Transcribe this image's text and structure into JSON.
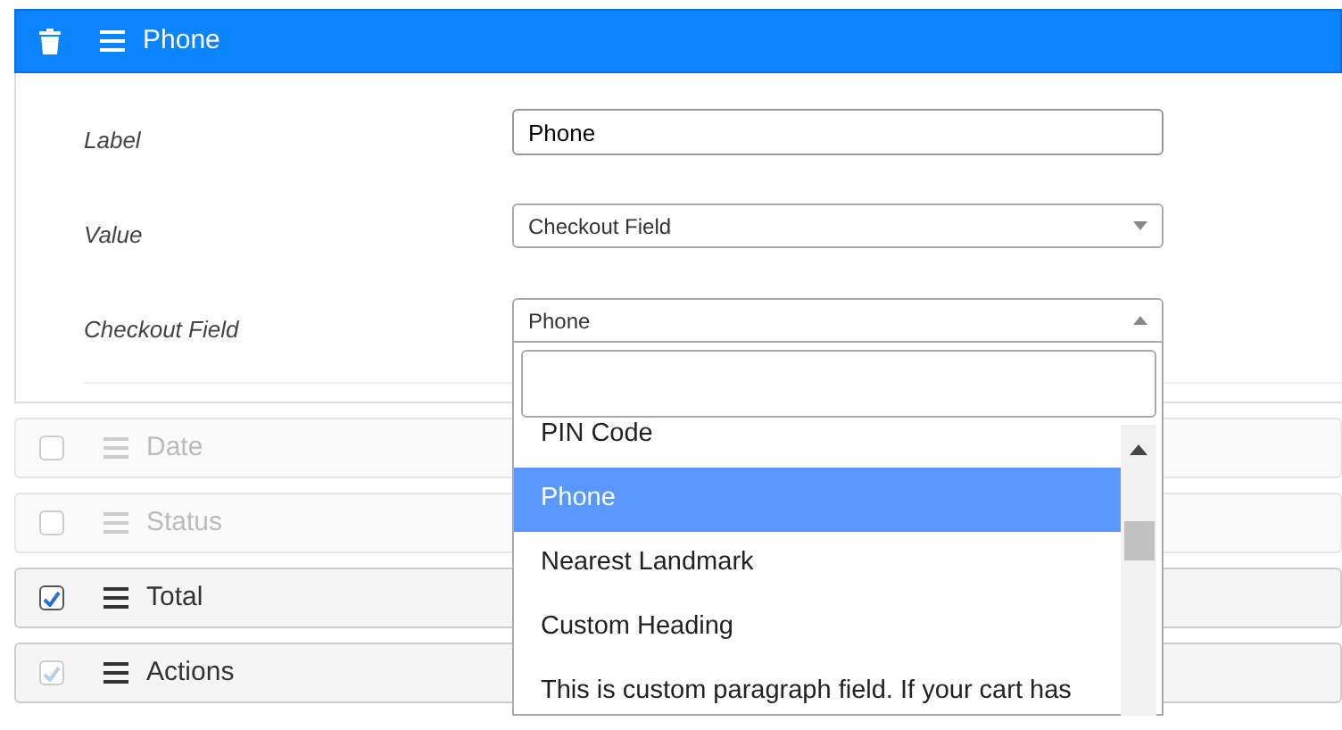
{
  "panel": {
    "title": "Phone",
    "fields": [
      {
        "label": "Label",
        "kind": "text",
        "value": "Phone"
      },
      {
        "label": "Value",
        "kind": "select",
        "value": "Checkout Field",
        "open": false
      },
      {
        "label": "Checkout Field",
        "kind": "select",
        "value": "Phone",
        "open": true
      }
    ]
  },
  "dropdown": {
    "options": [
      {
        "label": "PIN Code",
        "selected": false
      },
      {
        "label": "Phone",
        "selected": true
      },
      {
        "label": "Nearest Landmark",
        "selected": false
      },
      {
        "label": "Custom Heading",
        "selected": false
      },
      {
        "label": "This is custom paragraph field. If your cart has",
        "selected": false
      }
    ]
  },
  "columns": [
    {
      "label": "Date",
      "checked": false,
      "disabled": true,
      "dimmed": true
    },
    {
      "label": "Status",
      "checked": false,
      "disabled": true,
      "dimmed": true
    },
    {
      "label": "Total",
      "checked": true,
      "disabled": false,
      "dimmed": false
    },
    {
      "label": "Actions",
      "checked": true,
      "disabled": true,
      "dimmed": false
    }
  ]
}
